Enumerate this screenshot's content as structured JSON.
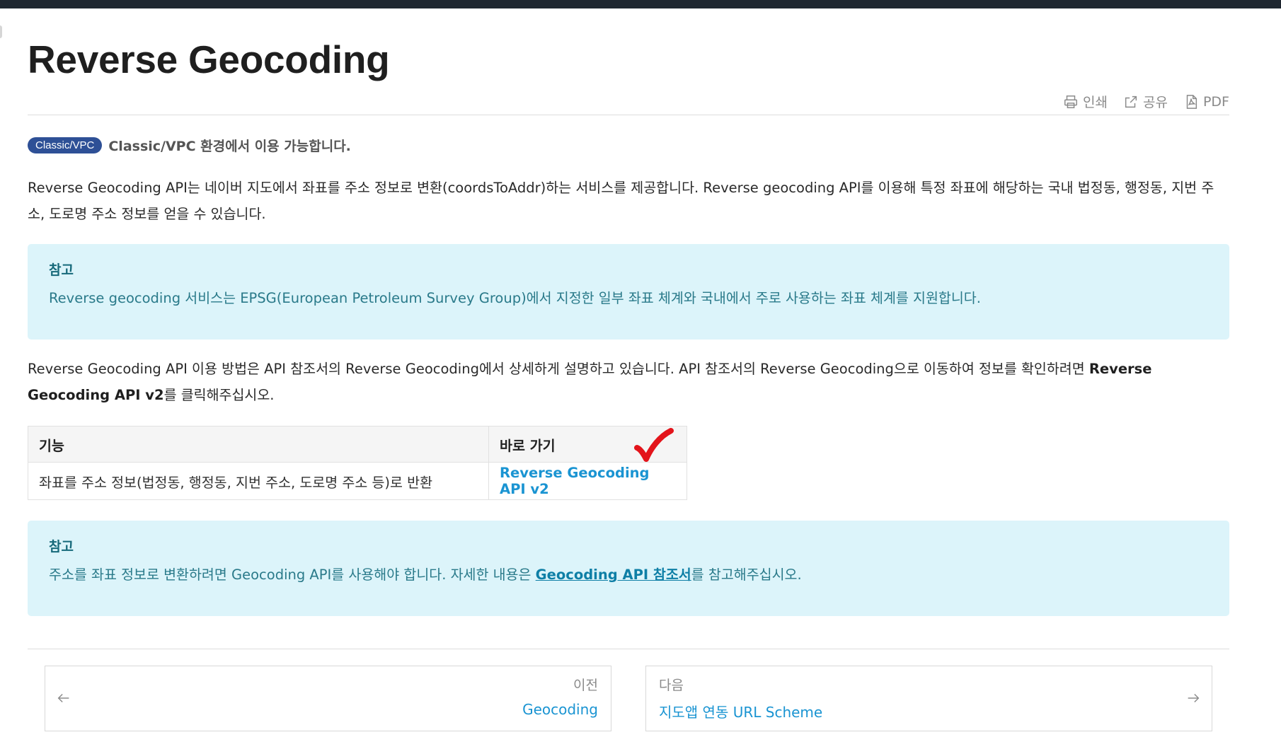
{
  "page": {
    "title": "Reverse Geocoding"
  },
  "toolbar": {
    "print_label": "인쇄",
    "share_label": "공유",
    "pdf_label": "PDF"
  },
  "environment": {
    "badge": "Classic/VPC",
    "text": "Classic/VPC 환경에서 이용 가능합니다."
  },
  "intro": {
    "text": "Reverse Geocoding API는 네이버 지도에서 좌표를 주소 정보로 변환(coordsToAddr)하는 서비스를 제공합니다. Reverse geocoding API를 이용해 특정 좌표에 해당하는 국내 법정동, 행정동, 지번 주소, 도로명 주소 정보를 얻을 수 있습니다."
  },
  "note1": {
    "title": "참고",
    "text": "Reverse geocoding 서비스는 EPSG(European Petroleum Survey Group)에서 지정한 일부 좌표 체계와 국내에서 주로 사용하는 좌표 체계를 지원합니다."
  },
  "usage": {
    "text_before": "Reverse Geocoding API 이용 방법은 API 참조서의 Reverse Geocoding에서 상세하게 설명하고 있습니다. API 참조서의 Reverse Geocoding으로 이동하여 정보를 확인하려면 ",
    "bold": "Reverse Geocoding API v2",
    "text_after": "를 클릭해주십시오."
  },
  "table": {
    "headers": [
      "기능",
      "바로 가기"
    ],
    "rows": [
      {
        "feature": "좌표를 주소 정보(법정동, 행정동, 지번 주소, 도로명 주소 등)로 반환",
        "link": "Reverse Geocoding API v2"
      }
    ]
  },
  "note2": {
    "title": "참고",
    "text_before": "주소를 좌표 정보로 변환하려면 Geocoding API를 사용해야 합니다. 자세한 내용은 ",
    "link": "Geocoding API 참조서",
    "text_after": "를 참고해주십시오."
  },
  "pagination": {
    "prev_label": "이전",
    "prev_title": "Geocoding",
    "next_label": "다음",
    "next_title": "지도앱 연동 URL Scheme"
  },
  "colors": {
    "badge": "#2e5096",
    "note_bg": "#dcf4fa",
    "link": "#1a94d2",
    "checkmark": "#e3141b"
  },
  "icons": [
    "print-icon",
    "share-icon",
    "pdf-icon",
    "checkmark-icon",
    "arrow-left-icon",
    "arrow-right-icon"
  ]
}
